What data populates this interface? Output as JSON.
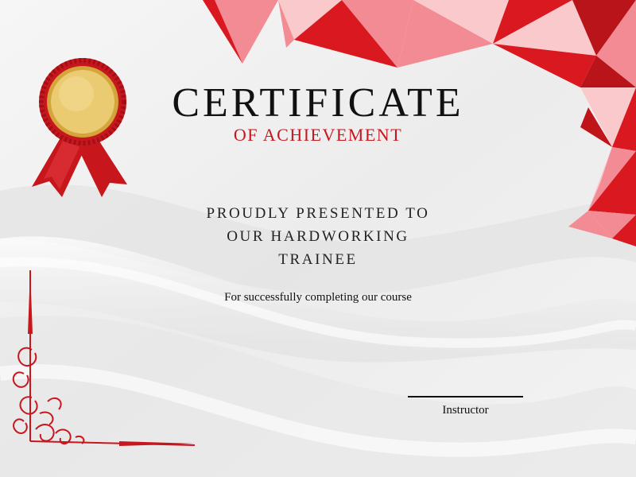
{
  "certificate": {
    "title": "CERTIFICATE",
    "subtitle": "OF ACHIEVEMENT",
    "presented_line1": "PROUDLY PRESENTED TO",
    "presented_line2": "OUR HARDWORKING",
    "presented_line3": "TRAINEE",
    "reason": "For successfully completing our course",
    "signature_label": "Instructor"
  },
  "colors": {
    "accent_red": "#c8161d",
    "pink": "#f28b93",
    "light_pink": "#f9c9cc",
    "gold": "#e7c56a"
  },
  "icons": {
    "medal": "award-ribbon-icon",
    "corner_ornament": "swirl-ornament-icon"
  }
}
